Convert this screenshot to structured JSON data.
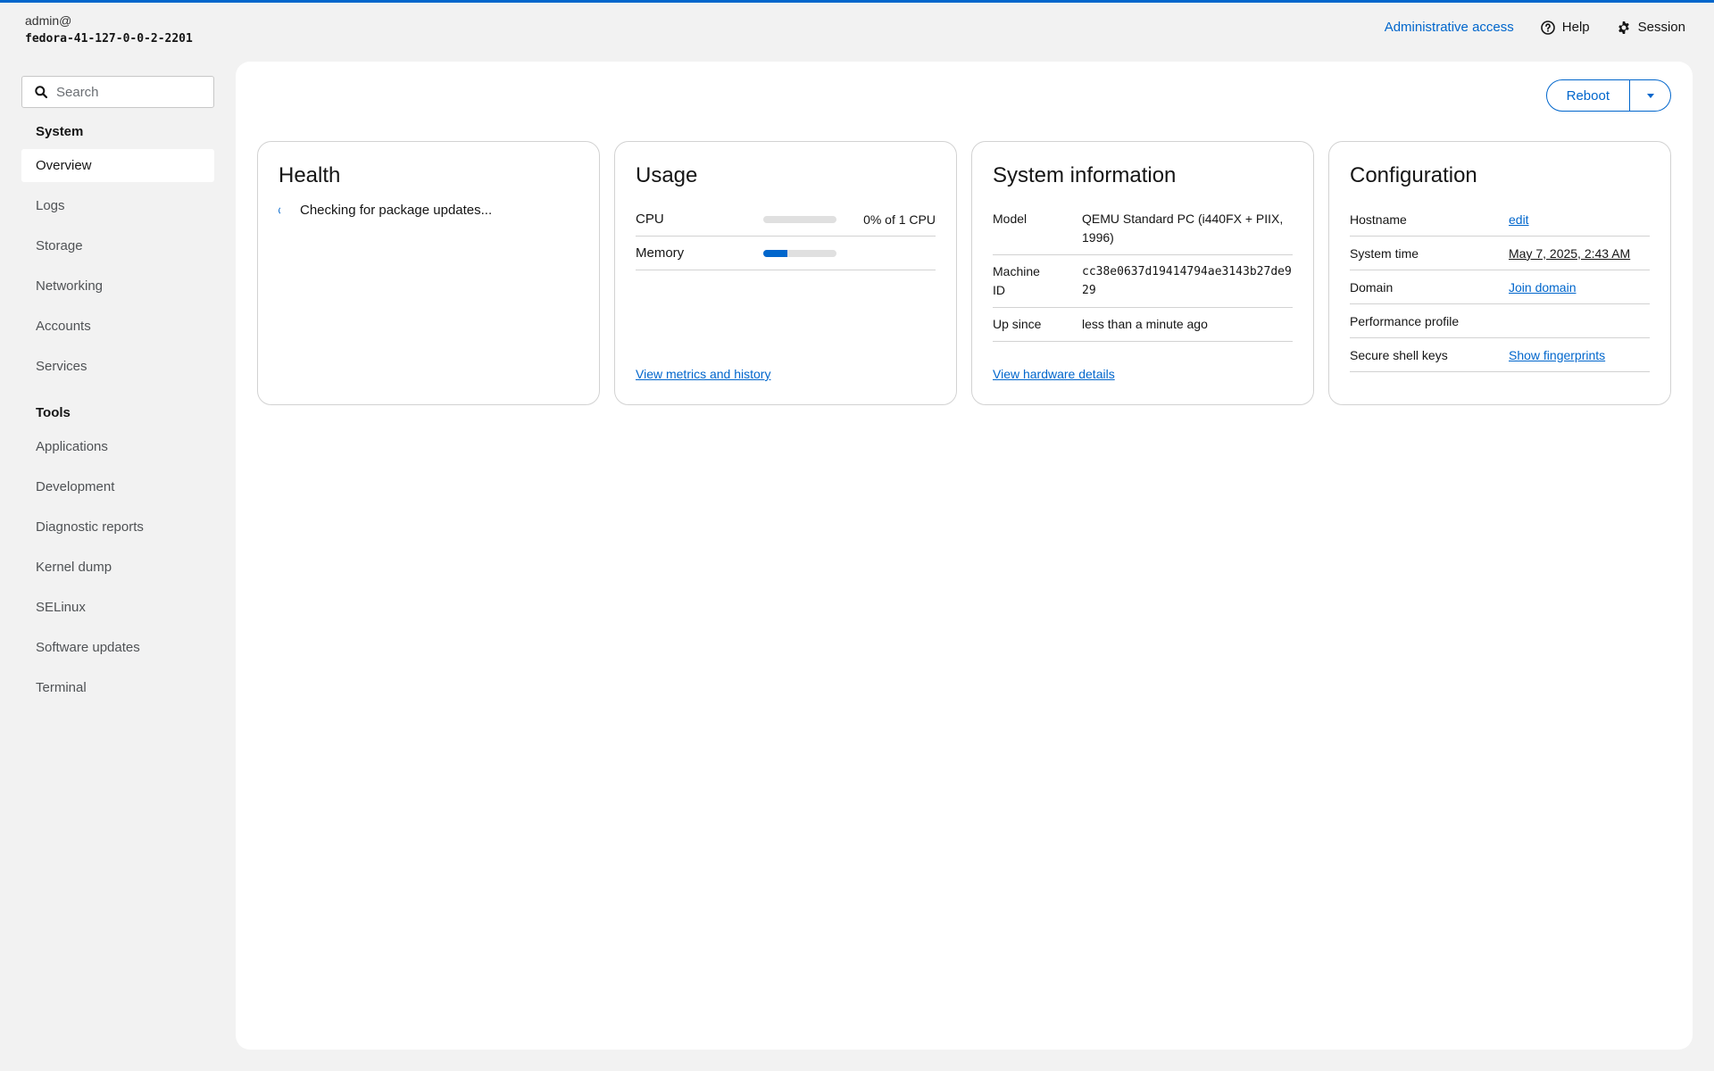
{
  "host": {
    "user": "admin@",
    "hostname": "fedora-41-127-0-0-2-2201"
  },
  "header": {
    "admin_access": "Administrative access",
    "help": "Help",
    "session": "Session"
  },
  "search": {
    "placeholder": "Search"
  },
  "sidebar": {
    "system_title": "System",
    "system_items": [
      "Overview",
      "Logs",
      "Storage",
      "Networking",
      "Accounts",
      "Services"
    ],
    "tools_title": "Tools",
    "tools_items": [
      "Applications",
      "Development",
      "Diagnostic reports",
      "Kernel dump",
      "SELinux",
      "Software updates",
      "Terminal"
    ]
  },
  "toolbar": {
    "reboot_label": "Reboot"
  },
  "health": {
    "title": "Health",
    "status": "Checking for package updates..."
  },
  "usage": {
    "title": "Usage",
    "cpu_label": "CPU",
    "cpu_value": "0% of 1 CPU",
    "cpu_fraction": 0,
    "memory_label": "Memory",
    "memory_fraction": 0.33,
    "link": "View metrics and history"
  },
  "sysinfo": {
    "title": "System information",
    "model_label": "Model",
    "model_value": "QEMU Standard PC (i440FX + PIIX, 1996)",
    "machine_id_label": "Machine ID",
    "machine_id_value": "cc38e0637d19414794ae3143b27de929",
    "up_since_label": "Up since",
    "up_since_value": "less than a minute ago",
    "link": "View hardware details"
  },
  "config": {
    "title": "Configuration",
    "hostname_label": "Hostname",
    "hostname_value": "edit",
    "time_label": "System time",
    "time_value": "May 7, 2025, 2:43 AM",
    "domain_label": "Domain",
    "domain_value": "Join domain",
    "perf_label": "Performance profile",
    "ssh_label": "Secure shell keys",
    "ssh_value": "Show fingerprints"
  },
  "colors": {
    "accent": "#0066cc",
    "background": "#f2f2f2"
  }
}
